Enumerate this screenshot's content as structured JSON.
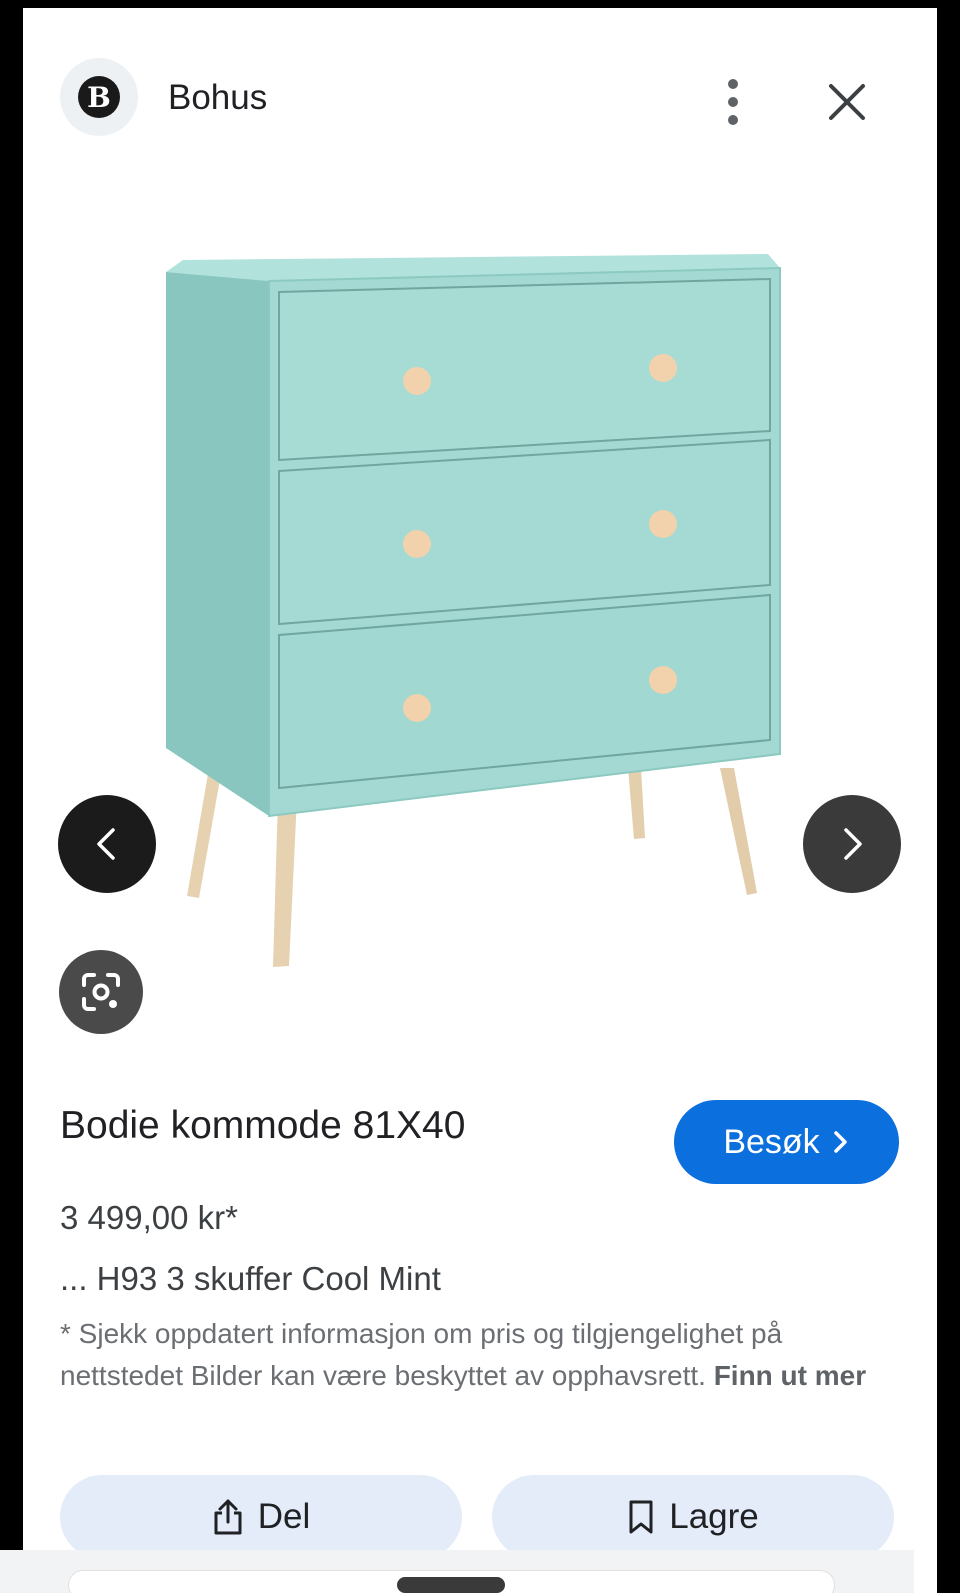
{
  "header": {
    "logo_letter": "B",
    "site_name": "Bohus"
  },
  "product": {
    "title": "Bodie kommode 81X40",
    "price": "3 499,00 kr*",
    "subtitle": "... H93 3 skuffer Cool Mint",
    "disclaimer": "* Sjekk oppdatert informasjon om pris og tilgjengelighet på nettstedet Bilder kan være beskyttet av opphavsrett.",
    "learn_more": "Finn ut mer"
  },
  "buttons": {
    "visit": "Besøk",
    "share": "Del",
    "save": "Lagre"
  },
  "icons": {
    "more": "more-vert-icon",
    "close": "close-icon",
    "prev": "chevron-left-icon",
    "next": "chevron-right-icon",
    "lens": "lens-icon",
    "share": "share-icon",
    "save": "bookmark-icon"
  },
  "colors": {
    "accent": "#0b6fde",
    "dresser": "#9fd6cf",
    "knob": "#f1d2ad",
    "legs": "#e4cfad"
  }
}
